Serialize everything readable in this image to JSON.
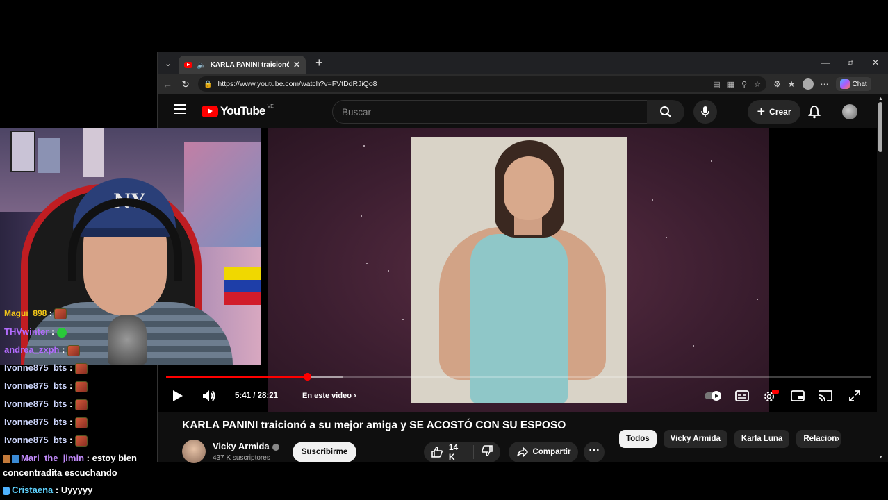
{
  "browser": {
    "tab_title": "KARLA PANINI traicionó a su",
    "url": "https://www.youtube.com/watch?v=FVtDdRJiQo8",
    "chat_label": "Chat"
  },
  "youtube": {
    "logo_text": "YouTube",
    "country_code": "VE",
    "search_placeholder": "Buscar",
    "create_label": "Crear"
  },
  "player": {
    "time": "5:41 / 28:21",
    "chapters_label": "En este video",
    "progress_fraction": 0.2,
    "buffered_fraction": 0.25
  },
  "video_info": {
    "title": "KARLA PANINI traicionó a su mejor amiga y SE ACOSTÓ CON SU ESPOSO",
    "channel": "Vicky Armida",
    "subscribers": "437 K suscriptores",
    "subscribe_label": "Suscribirme",
    "likes": "14 K",
    "share_label": "Compartir",
    "chips": [
      "Todos",
      "Vicky Armida",
      "Karla Luna",
      "Relacion"
    ]
  },
  "stream_chat": {
    "messages": [
      {
        "user": "Magui_898",
        "text": "",
        "color": "#f0c419"
      },
      {
        "user": "THVwinter",
        "text": "",
        "color": "#b46cff"
      },
      {
        "user": "andrea_zxph",
        "text": "",
        "color": "#b46cff"
      },
      {
        "user": "Ivonne875_bts",
        "text": "",
        "color": "#cfd8ff"
      },
      {
        "user": "Ivonne875_bts",
        "text": "",
        "color": "#cfd8ff"
      },
      {
        "user": "Ivonne875_bts",
        "text": "",
        "color": "#cfd8ff"
      },
      {
        "user": "Ivonne875_bts",
        "text": "",
        "color": "#cfd8ff"
      },
      {
        "user": "Ivonne875_bts",
        "text": "",
        "color": "#cfd8ff"
      },
      {
        "user": "Mari_the_jimin",
        "text": "estoy bien concentradita escuchando",
        "color": "#c58cff"
      },
      {
        "user": "Cristaena",
        "text": "Uyyyyy",
        "color": "#5fd3ff"
      }
    ]
  },
  "colors": {
    "accent": "#ff0000",
    "background": "#0f0f0f"
  }
}
